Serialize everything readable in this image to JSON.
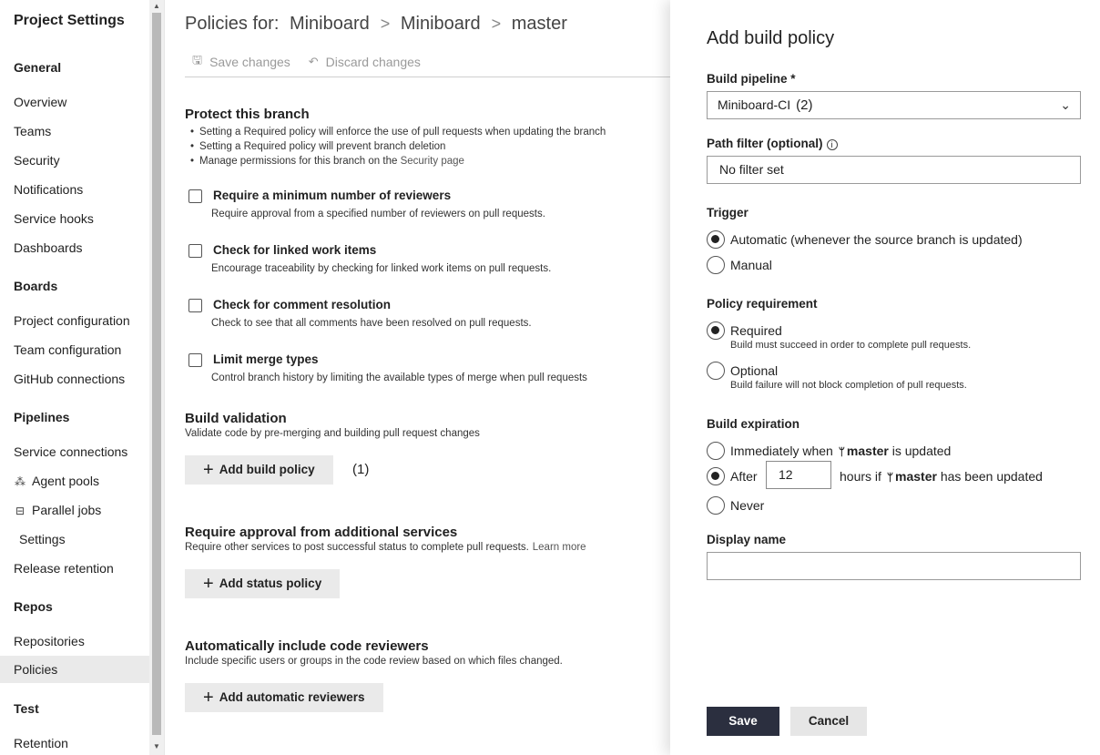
{
  "sidebar": {
    "title": "Project Settings",
    "sections": [
      {
        "name": "General",
        "items": [
          "Overview",
          "Teams",
          "Security",
          "Notifications",
          "Service hooks",
          "Dashboards"
        ]
      },
      {
        "name": "Boards",
        "items": [
          "Project configuration",
          "Team configuration",
          "GitHub connections"
        ]
      },
      {
        "name": "Pipelines",
        "items": [
          "Service connections",
          "Agent pools",
          "Parallel jobs",
          "Settings",
          "Release retention"
        ]
      },
      {
        "name": "Repos",
        "items": [
          "Repositories",
          "Policies"
        ]
      },
      {
        "name": "Test",
        "items": [
          "Retention"
        ]
      }
    ],
    "active_item": "Policies"
  },
  "main": {
    "breadcrumb_prefix": "Policies for:",
    "breadcrumb": [
      "Miniboard",
      "Miniboard",
      "master"
    ],
    "toolbar": {
      "save": "Save changes",
      "discard": "Discard changes"
    },
    "protect": {
      "title": "Protect this branch",
      "bullets": [
        "Setting a Required policy will enforce the use of pull requests when updating the branch",
        "Setting a Required policy will prevent branch deletion"
      ],
      "bullet3_prefix": "Manage permissions for this branch on the",
      "bullet3_link": "Security page"
    },
    "checks": [
      {
        "label": "Require a minimum number of reviewers",
        "desc": "Require approval from a specified number of reviewers on pull requests."
      },
      {
        "label": "Check for linked work items",
        "desc": "Encourage traceability by checking for linked work items on pull requests."
      },
      {
        "label": "Check for comment resolution",
        "desc": "Check to see that all comments have been resolved on pull requests."
      },
      {
        "label": "Limit merge types",
        "desc": "Control branch history by limiting the available types of merge when pull requests"
      }
    ],
    "build_validation": {
      "title": "Build validation",
      "desc": "Validate code by pre-merging and building pull request changes",
      "button": "Add build policy",
      "annotation": "(1)"
    },
    "status": {
      "title": "Require approval from additional services",
      "desc": "Require other services to post successful status to complete pull requests.",
      "link": "Learn more",
      "button": "Add status policy"
    },
    "reviewers": {
      "title": "Automatically include code reviewers",
      "desc": "Include specific users or groups in the code review based on which files changed.",
      "button": "Add automatic reviewers"
    }
  },
  "panel": {
    "title": "Add build policy",
    "pipeline_label": "Build pipeline *",
    "pipeline_value": "Miniboard-CI",
    "pipeline_annotation": "(2)",
    "path_label": "Path filter (optional)",
    "path_value": "No filter set",
    "trigger_label": "Trigger",
    "trigger_automatic": "Automatic (whenever the source branch is updated)",
    "trigger_manual": "Manual",
    "requirement_label": "Policy requirement",
    "required": "Required",
    "required_desc": "Build must succeed in order to complete pull requests.",
    "optional": "Optional",
    "optional_desc": "Build failure will not block completion of pull requests.",
    "expiration_label": "Build expiration",
    "exp_immediately": "Immediately when",
    "exp_immediately_suffix": "is updated",
    "branch": "master",
    "exp_after": "After",
    "exp_hours": "12",
    "exp_hours_prefix": "hours if",
    "exp_hours_suffix": "has been updated",
    "exp_never": "Never",
    "display_name_label": "Display name",
    "display_name_value": "",
    "save": "Save",
    "cancel": "Cancel"
  }
}
